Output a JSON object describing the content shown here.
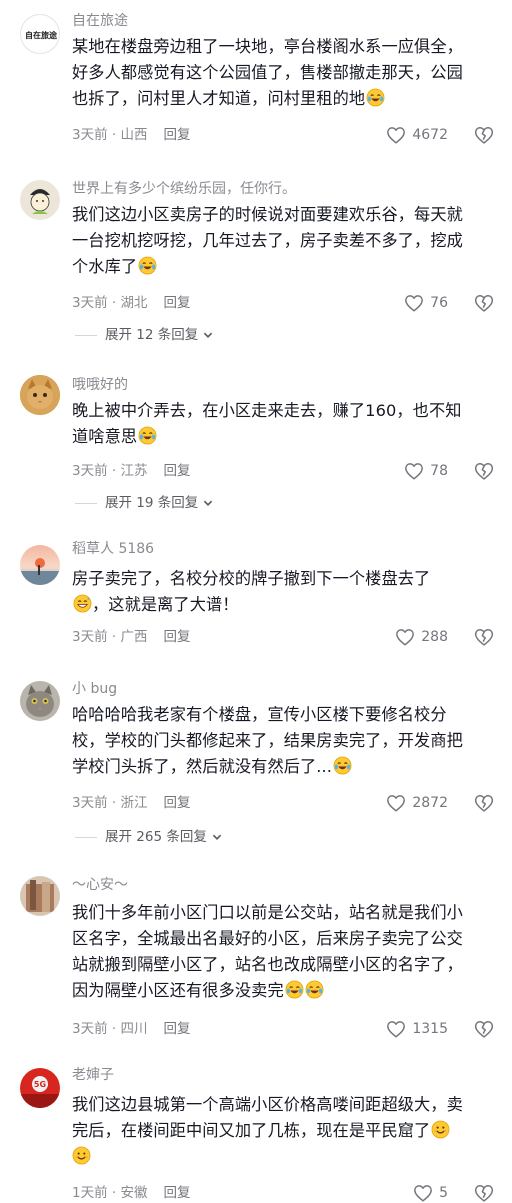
{
  "colors": {
    "text": "#161823",
    "meta": "#8a8b91",
    "emoji_face": "#ffc933"
  },
  "comments": [
    {
      "username": "自在旅途",
      "avatar_text": "自在旅途",
      "lines": [
        "某地在楼盘旁边租了一块地，亭台楼阁水系一应俱全，",
        "好多人都感觉有这个公园值了，售楼部撤走那天，公园",
        "也拆了，问村里人才知道，问村里租的地"
      ],
      "meta": "3天前 · 山西",
      "reply": "回复",
      "likes": "4672"
    },
    {
      "username": "世界上有多少个缤纷乐园，任你行。",
      "lines": [
        "我们这边小区卖房子的时候说对面要建欢乐谷，每天就",
        "一台挖机挖呀挖，几年过去了，房子卖差不多了，挖成",
        "个水库了"
      ],
      "meta": "3天前 · 湖北",
      "reply": "回复",
      "likes": "76",
      "expand": "展开 12 条回复"
    },
    {
      "username": "哦哦好的",
      "lines": [
        "晚上被中介弄去，在小区走来走去，赚了160，也不知",
        "道啥意思"
      ],
      "meta": "3天前 · 江苏",
      "reply": "回复",
      "likes": "78",
      "expand": "展开 19 条回复"
    },
    {
      "username": "稻草人 5186",
      "lines": [
        "房子卖完了，名校分校的牌子撤到下一个楼盘去了",
        "，这就是离了大谱！"
      ],
      "meta": "3天前 · 广西",
      "reply": "回复",
      "likes": "288"
    },
    {
      "username": "小 bug",
      "lines": [
        "哈哈哈哈我老家有个楼盘，宣传小区楼下要修名校分",
        "校，学校的门头都修起来了，结果房卖完了，开发商把",
        "学校门头拆了，然后就没有然后了..."
      ],
      "meta": "3天前 · 浙江",
      "reply": "回复",
      "likes": "2872",
      "expand": "展开 265 条回复"
    },
    {
      "username": "～心安～",
      "lines": [
        "我们十多年前小区门口以前是公交站，站名就是我们小",
        "区名字，全城最出名最好的小区，后来房子卖完了公交",
        "站就搬到隔壁小区了，站名也改成隔壁小区的名字了，",
        "因为隔壁小区还有很多没卖完"
      ],
      "meta": "3天前 · 四川",
      "reply": "回复",
      "likes": "1315"
    },
    {
      "username": "老婶子",
      "avatar_text": "5G",
      "lines": [
        "我们这边县城第一个高端小区价格高喽间距超级大，卖",
        "完后，在楼间距中间又加了几栋，现在是平民窟了",
        ""
      ],
      "meta": "1天前 · 安徽",
      "reply": "回复",
      "likes": "5"
    }
  ]
}
